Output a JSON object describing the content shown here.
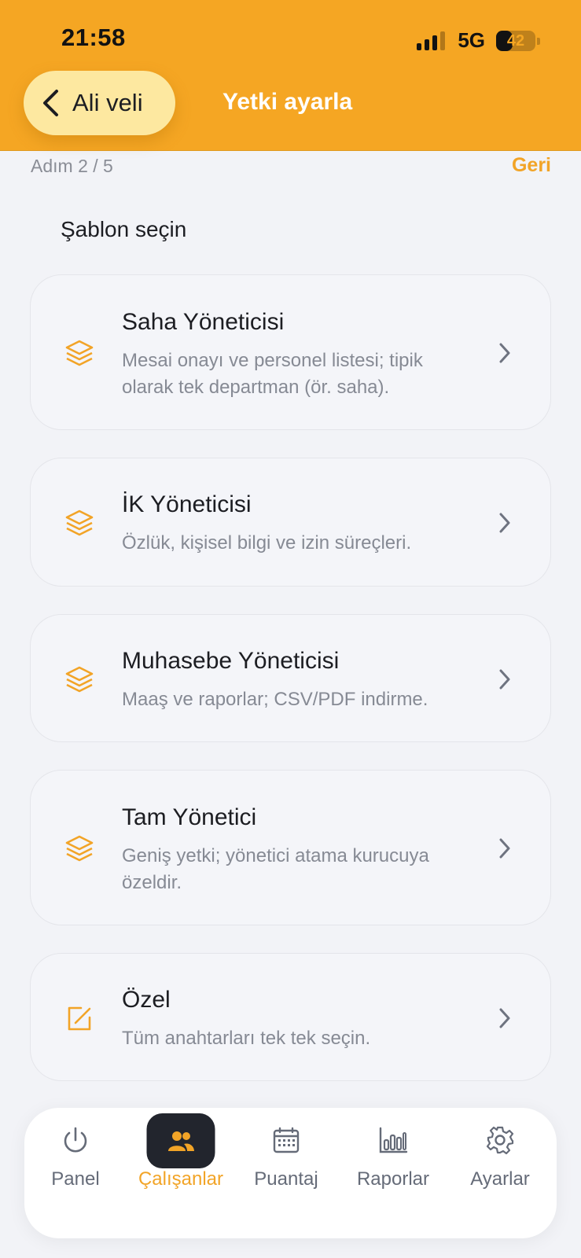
{
  "status_bar": {
    "time": "21:58",
    "network": "5G",
    "battery": "42",
    "battery_level": 0.42
  },
  "header": {
    "back_label": "Ali veli",
    "title": "Yetki ayarla"
  },
  "stepper": {
    "step_text": "Adım 2 / 5",
    "back_link": "Geri"
  },
  "section_title": "Şablon seçin",
  "templates": [
    {
      "title": "Saha Yöneticisi",
      "description": "Mesai onayı ve personel listesi; tipik olarak tek departman (ör. saha).",
      "icon": "layers-icon"
    },
    {
      "title": "İK Yöneticisi",
      "description": "Özlük, kişisel bilgi ve izin süreçleri.",
      "icon": "layers-icon"
    },
    {
      "title": "Muhasebe Yöneticisi",
      "description": "Maaş ve raporlar; CSV/PDF indirme.",
      "icon": "layers-icon"
    },
    {
      "title": "Tam Yönetici",
      "description": "Geniş yetki; yönetici atama kurucuya özeldir.",
      "icon": "layers-icon"
    },
    {
      "title": "Özel",
      "description": "Tüm anahtarları tek tek seçin.",
      "icon": "edit-icon"
    }
  ],
  "tabbar": {
    "active": "Çalışanlar",
    "items": [
      {
        "label": "Panel",
        "icon": "power-icon"
      },
      {
        "label": "Çalışanlar",
        "icon": "users-icon"
      },
      {
        "label": "Puantaj",
        "icon": "calendar-icon"
      },
      {
        "label": "Raporlar",
        "icon": "bar-chart-icon"
      },
      {
        "label": "Ayarlar",
        "icon": "gear-icon"
      }
    ]
  },
  "colors": {
    "accent": "#f5a623",
    "accent_text": "#f2a427",
    "background": "#f2f3f7",
    "card": "#f4f5f9",
    "tab_active_bg": "#22252d"
  }
}
